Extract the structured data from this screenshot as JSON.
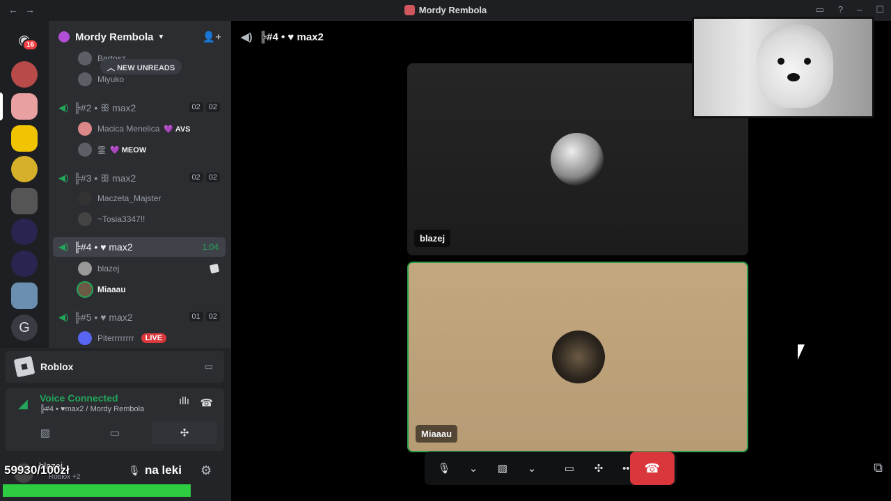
{
  "titlebar": {
    "title": "Mordy Rembola",
    "back": "←",
    "forward": "→",
    "inbox_icon": "inbox-icon",
    "help_icon": "help-icon",
    "min": "‒",
    "max": "☐"
  },
  "rail": {
    "dm_badge": "16",
    "servers": [
      "server-1",
      "server-2",
      "server-3",
      "server-4",
      "server-5",
      "server-6",
      "server-7",
      "server-8",
      "server-9"
    ]
  },
  "sidebar": {
    "guild_name": "Mordy Rembola",
    "new_unreads": "NEW UNREADS",
    "members_top": [
      "Bartosz",
      "Miyuko"
    ],
    "channels": [
      {
        "prefix": "╠#2",
        "sep": "•",
        "heart": "ꕥ",
        "name": "max2",
        "c1": "02",
        "c2": "02"
      },
      {
        "prefix": "╠#3",
        "sep": "•",
        "heart": "ꕥ",
        "name": "max2",
        "c1": "02",
        "c2": "02"
      },
      {
        "prefix": "╠#4",
        "sep": "•",
        "heart": "♥",
        "name": "max2",
        "time": "1:04"
      },
      {
        "prefix": "╠#5",
        "sep": "•",
        "heart": "♥",
        "name": "max2",
        "c1": "01",
        "c2": "02"
      }
    ],
    "ch2_members": [
      {
        "name": "Macica Menelica",
        "tag": "💜 AVS"
      },
      {
        "name": "霊",
        "tag": "💜 MEOW"
      }
    ],
    "ch3_members": [
      "Maczeta_Majster",
      "~Tosia3347!!"
    ],
    "ch4_members": [
      "blazej",
      "Miaaau"
    ],
    "ch5_members": [
      {
        "name": "Piterrrrrrrr",
        "live": "LIVE"
      }
    ]
  },
  "panel": {
    "activity": "Roblox",
    "voice_status": "Voice Connected",
    "voice_channel": "╠#4 • ♥max2 / Mordy Rembola",
    "overlay_count": "59930/100zł",
    "overlay_label": "na leki",
    "user_name": "blazej",
    "user_status": "Roblox +2",
    "progress": 0.5993,
    "progress_color": "#2ecc40"
  },
  "main": {
    "header": "╠#4 • ♥ max2",
    "tiles": [
      {
        "name": "blazej"
      },
      {
        "name": "Miaaau"
      }
    ]
  },
  "colors": {
    "accent_green": "#23a55a",
    "danger": "#da373c",
    "bg": "#000000"
  }
}
